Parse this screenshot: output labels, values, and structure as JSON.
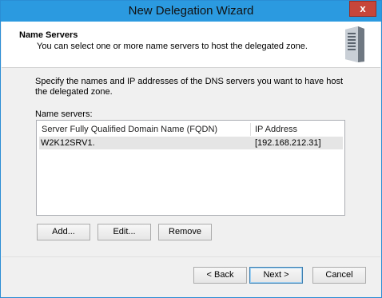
{
  "window": {
    "title": "New Delegation Wizard",
    "close_glyph": "x"
  },
  "header": {
    "title": "Name Servers",
    "subtitle": "You can select one or more name servers to host the delegated zone.",
    "icon": "server-icon"
  },
  "body": {
    "description": "Specify the names and IP addresses of the DNS servers you want to have host the delegated zone.",
    "list_label": "Name servers:"
  },
  "name_servers": {
    "columns": [
      "Server Fully Qualified Domain Name (FQDN)",
      "IP Address"
    ],
    "rows": [
      {
        "fqdn": "W2K12SRV1.",
        "ip": "[192.168.212.31]"
      }
    ]
  },
  "list_buttons": {
    "add": "Add...",
    "edit": "Edit...",
    "remove": "Remove"
  },
  "footer_buttons": {
    "back": "< Back",
    "next": "Next >",
    "cancel": "Cancel"
  },
  "colors": {
    "titlebar": "#2b9ae0",
    "close_button": "#c7463a",
    "selected_row": "#e5e5e5"
  }
}
